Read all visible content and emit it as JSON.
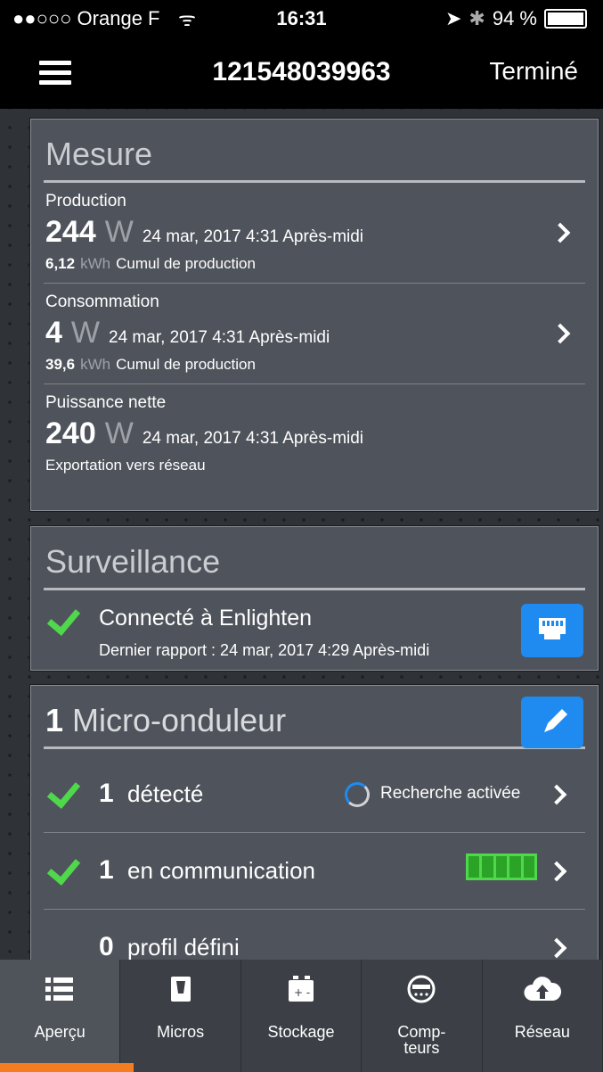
{
  "status": {
    "carrier": "●●○○○ Orange F",
    "time": "16:31",
    "battery": "94 %"
  },
  "nav": {
    "title": "121548039963",
    "done": "Terminé"
  },
  "mesure": {
    "title": "Mesure",
    "rows": [
      {
        "label": "Production",
        "value": "244",
        "unit": "W",
        "date": "24 mar, 2017 4:31 Après-midi",
        "cumul_value": "6,12",
        "cumul_unit": "kWh",
        "cumul_label": "Cumul de production"
      },
      {
        "label": "Consommation",
        "value": "4",
        "unit": "W",
        "date": "24 mar, 2017 4:31 Après-midi",
        "cumul_value": "39,6",
        "cumul_unit": "kWh",
        "cumul_label": "Cumul de production"
      },
      {
        "label": "Puissance nette",
        "value": "240",
        "unit": "W",
        "date": "24 mar, 2017 4:31 Après-midi",
        "note": "Exportation vers réseau"
      }
    ]
  },
  "surveillance": {
    "title": "Surveillance",
    "status": "Connecté à Enlighten",
    "last_report": "Dernier rapport : 24 mar, 2017 4:29 Après-midi"
  },
  "micro": {
    "count": "1",
    "title": "Micro-onduleur",
    "rows": [
      {
        "num": "1",
        "text": "détecté",
        "extra": "Recherche activée"
      },
      {
        "num": "1",
        "text": "en communication"
      },
      {
        "num": "0",
        "text": "profil défini"
      }
    ]
  },
  "tabs": [
    {
      "label": "Aperçu"
    },
    {
      "label": "Micros"
    },
    {
      "label": "Stockage"
    },
    {
      "label": "Comp-\nteurs"
    },
    {
      "label": "Réseau"
    }
  ],
  "colors": {
    "accent": "#1f8bf0",
    "ok": "#4fd84b",
    "active_tab": "#f57c1f"
  }
}
